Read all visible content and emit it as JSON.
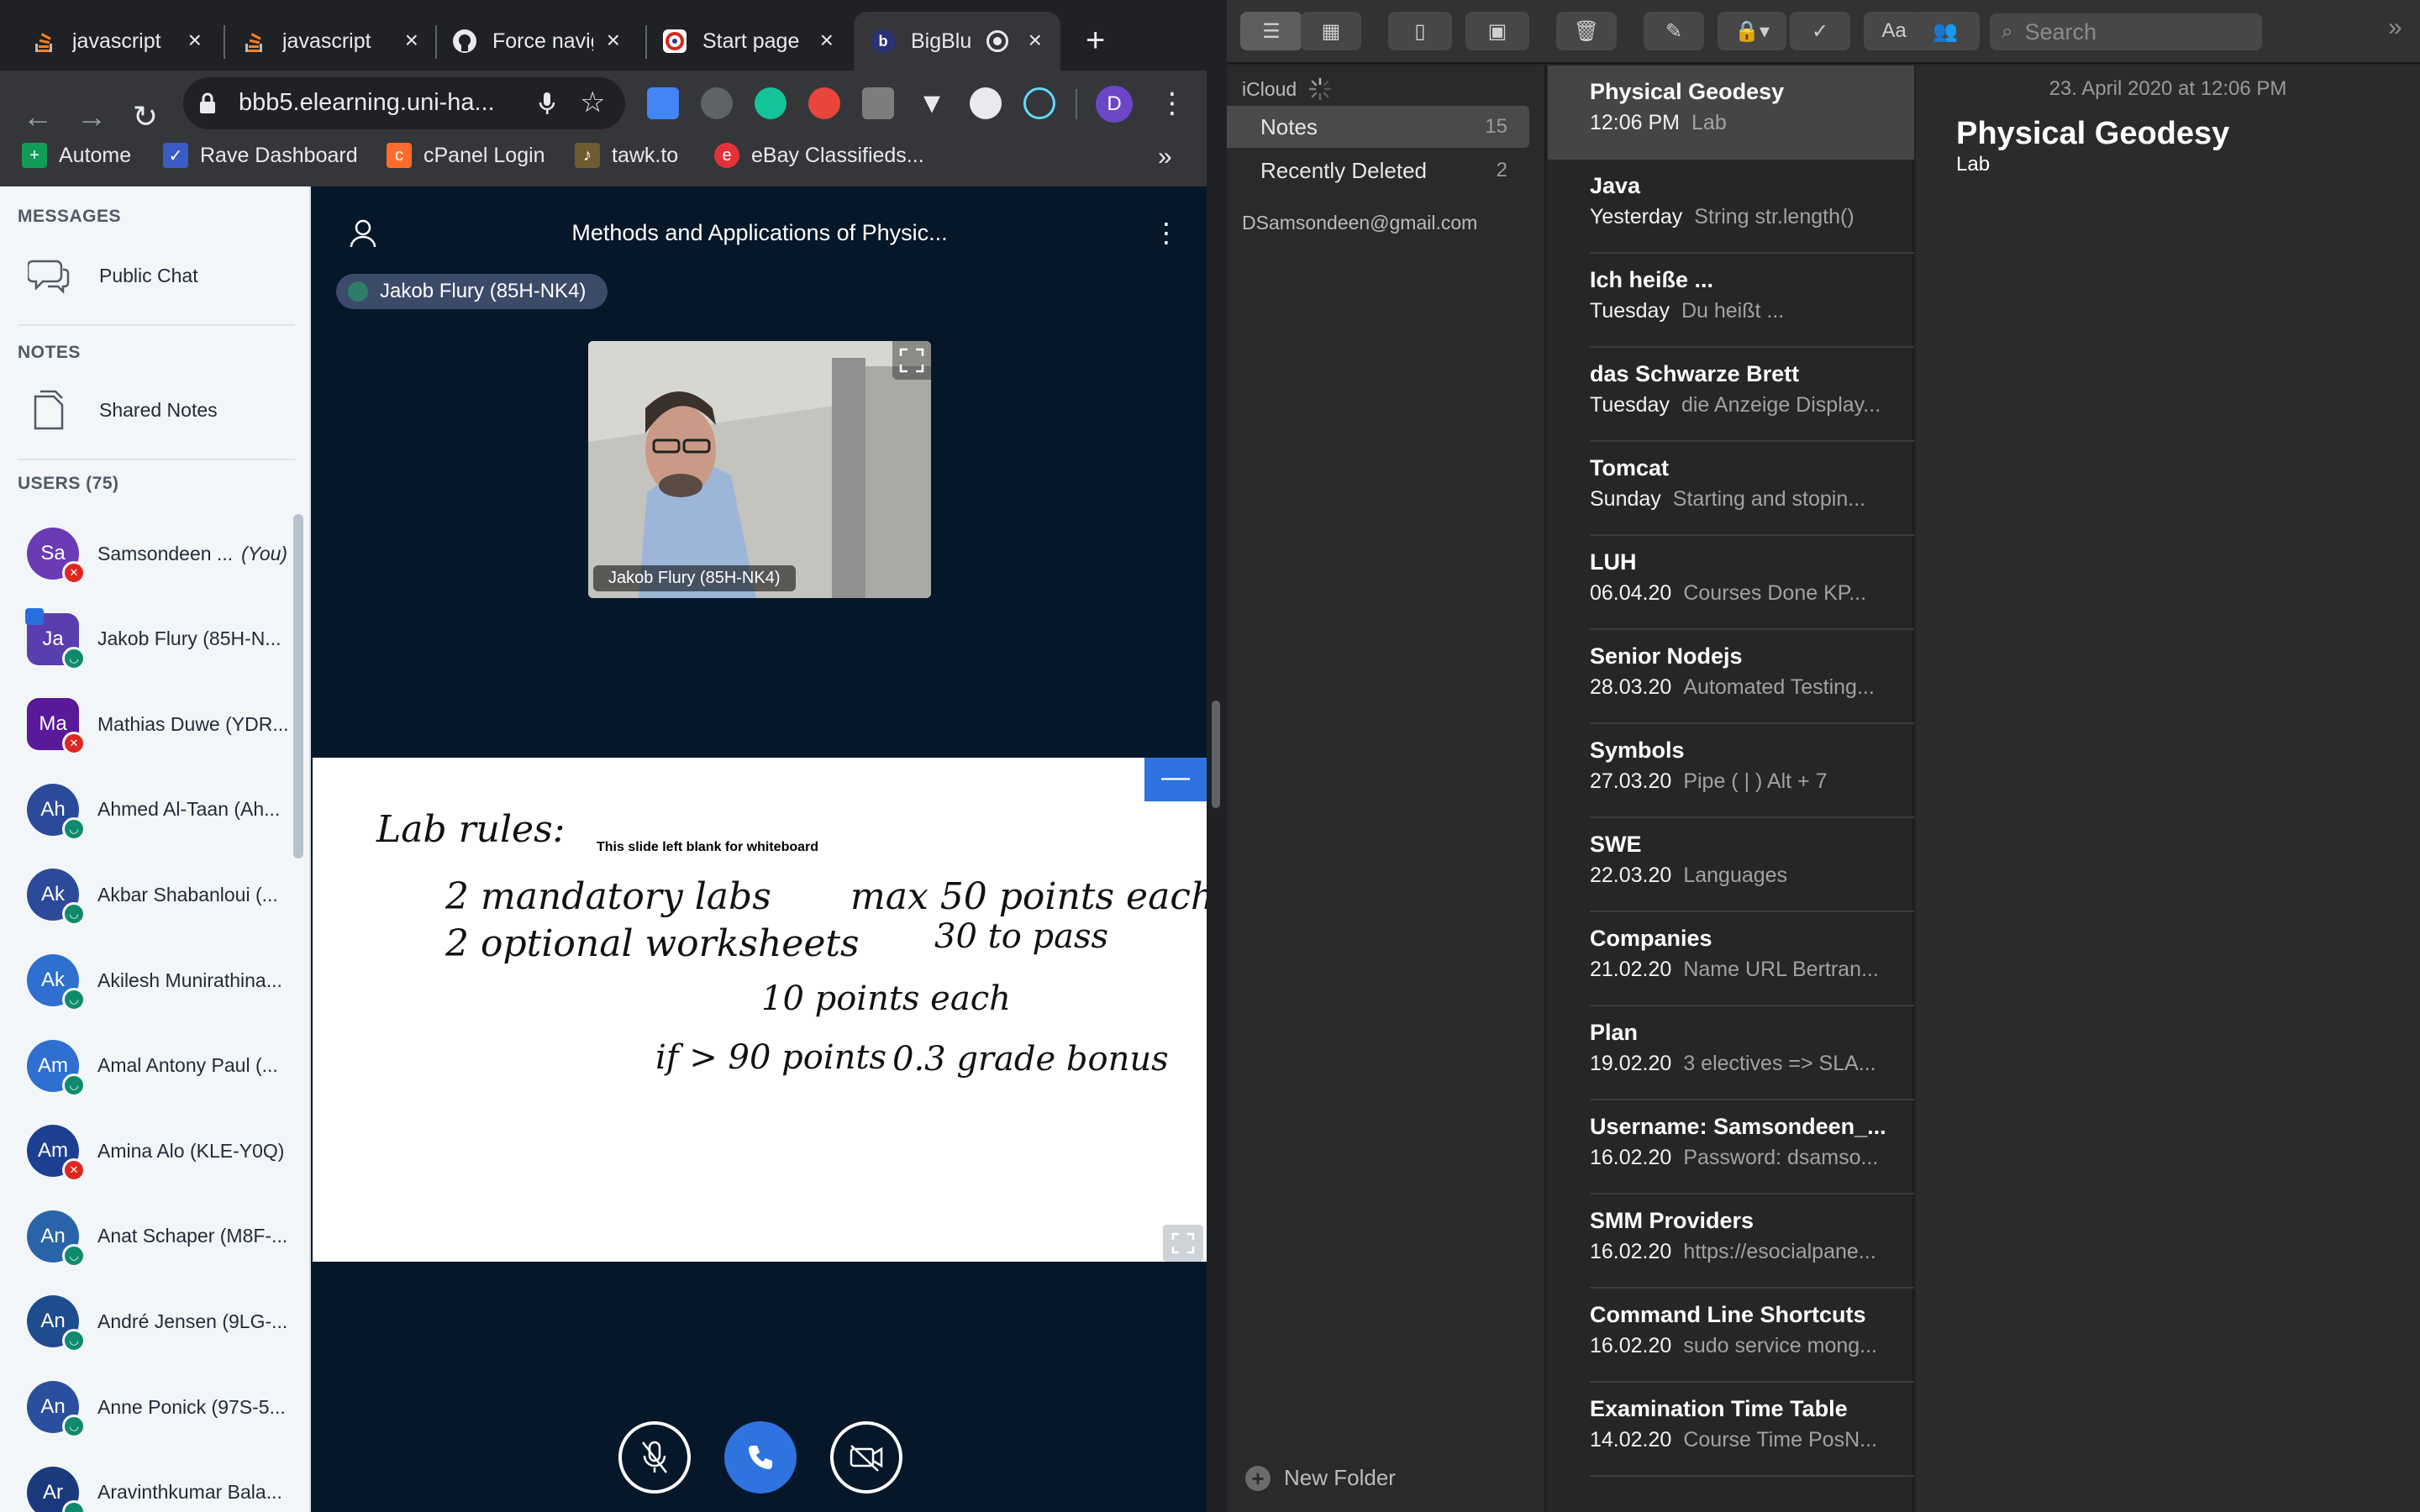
{
  "chrome": {
    "tabs": [
      {
        "label": "javascript",
        "icon": "stackoverflow-icon"
      },
      {
        "label": "javascript",
        "icon": "stackoverflow-icon"
      },
      {
        "label": "Force navig",
        "icon": "github-icon"
      },
      {
        "label": "Start page",
        "icon": "startpage-icon"
      },
      {
        "label": "BigBlu",
        "icon": "bigbluebutton-icon"
      }
    ],
    "url": "bbb5.elearning.uni-ha...",
    "profile_initial": "D",
    "bookmarks": [
      "Autome",
      "Rave Dashboard",
      "cPanel Login",
      "tawk.to",
      "eBay Classifieds..."
    ],
    "bookmarks_more": "»"
  },
  "bbb": {
    "sidebar": {
      "messages_header": "MESSAGES",
      "public_chat": "Public Chat",
      "notes_header": "NOTES",
      "shared_notes": "Shared Notes",
      "users_header": "USERS (75)",
      "you_label": "(You)",
      "users": [
        {
          "initials": "Sa",
          "name": "Samsondeen ...",
          "color": "#6a3bb5",
          "status": "muted",
          "shape": "round",
          "you": true
        },
        {
          "initials": "Ja",
          "name": "Jakob Flury (85H-N...",
          "color": "#5a3eb0",
          "status": "listen",
          "shape": "square",
          "presenter": true
        },
        {
          "initials": "Ma",
          "name": "Mathias Duwe (YDR...",
          "color": "#5a189a",
          "status": "muted",
          "shape": "square"
        },
        {
          "initials": "Ah",
          "name": "Ahmed Al-Taan (Ah...",
          "color": "#2c4a9a",
          "status": "listen",
          "shape": "round"
        },
        {
          "initials": "Ak",
          "name": "Akbar Shabanloui (...",
          "color": "#2c4a9a",
          "status": "listen",
          "shape": "round"
        },
        {
          "initials": "Ak",
          "name": "Akilesh Munirathina...",
          "color": "#2e6fd0",
          "status": "listen",
          "shape": "round"
        },
        {
          "initials": "Am",
          "name": "Amal Antony Paul (...",
          "color": "#2e6fd0",
          "status": "listen",
          "shape": "round"
        },
        {
          "initials": "Am",
          "name": "Amina Alo (KLE-Y0Q)",
          "color": "#1d3f91",
          "status": "muted",
          "shape": "round"
        },
        {
          "initials": "An",
          "name": "Anat Schaper (M8F-...",
          "color": "#2a64a8",
          "status": "listen",
          "shape": "round"
        },
        {
          "initials": "An",
          "name": "André Jensen (9LG-...",
          "color": "#1f4c8e",
          "status": "listen",
          "shape": "round"
        },
        {
          "initials": "An",
          "name": "Anne Ponick (97S-5...",
          "color": "#2a4f9e",
          "status": "listen",
          "shape": "round"
        },
        {
          "initials": "Ar",
          "name": "Aravinthkumar Bala...",
          "color": "#1b3a7e",
          "status": "listen",
          "shape": "round"
        }
      ]
    },
    "meeting_title": "Methods and Applications of Physic...",
    "talker": "Jakob Flury (85H-NK4)",
    "webcam_label": "Jakob Flury (85H-NK4)",
    "slide": {
      "minimize": "—",
      "caption": "This slide left blank for whiteboard",
      "handwriting": [
        "Lab rules:",
        "2 mandatory labs",
        "max 50 points each",
        "2 optional worksheets",
        "30 to pass",
        "10 points each",
        "if > 90 points",
        "0.3 grade bonus"
      ]
    }
  },
  "notes": {
    "search_placeholder": "Search",
    "account": "iCloud",
    "folders": [
      {
        "name": "Notes",
        "count": "15"
      },
      {
        "name": "Recently Deleted",
        "count": "2"
      }
    ],
    "gmail_account": "DSamsondeen@gmail.com",
    "new_folder": "New Folder",
    "list": [
      {
        "title": "Physical Geodesy",
        "date": "12:06 PM",
        "preview": "Lab"
      },
      {
        "title": "Java",
        "date": "Yesterday",
        "preview": "String str.length()"
      },
      {
        "title": "Ich heiße ...",
        "date": "Tuesday",
        "preview": "Du heißt ..."
      },
      {
        "title": "das Schwarze Brett",
        "date": "Tuesday",
        "preview": "die Anzeige Display..."
      },
      {
        "title": "Tomcat",
        "date": "Sunday",
        "preview": "Starting and stopin..."
      },
      {
        "title": "LUH",
        "date": "06.04.20",
        "preview": "Courses Done KP..."
      },
      {
        "title": "Senior Nodejs",
        "date": "28.03.20",
        "preview": "Automated Testing..."
      },
      {
        "title": "Symbols",
        "date": "27.03.20",
        "preview": "Pipe ( | ) Alt + 7"
      },
      {
        "title": "SWE",
        "date": "22.03.20",
        "preview": "Languages"
      },
      {
        "title": "Companies",
        "date": "21.02.20",
        "preview": "Name URL Bertran..."
      },
      {
        "title": "Plan",
        "date": "19.02.20",
        "preview": "3 electives => SLA..."
      },
      {
        "title": "Username: Samsondeen_...",
        "date": "16.02.20",
        "preview": "Password: dsamso..."
      },
      {
        "title": "SMM Providers",
        "date": "16.02.20",
        "preview": "https://esocialpane..."
      },
      {
        "title": "Command Line Shortcuts",
        "date": "16.02.20",
        "preview": "sudo service mong..."
      },
      {
        "title": "Examination Time Table",
        "date": "14.02.20",
        "preview": "Course Time PosN..."
      }
    ],
    "editor": {
      "date": "23. April 2020 at 12:06 PM",
      "title": "Physical Geodesy",
      "body": "Lab"
    }
  }
}
